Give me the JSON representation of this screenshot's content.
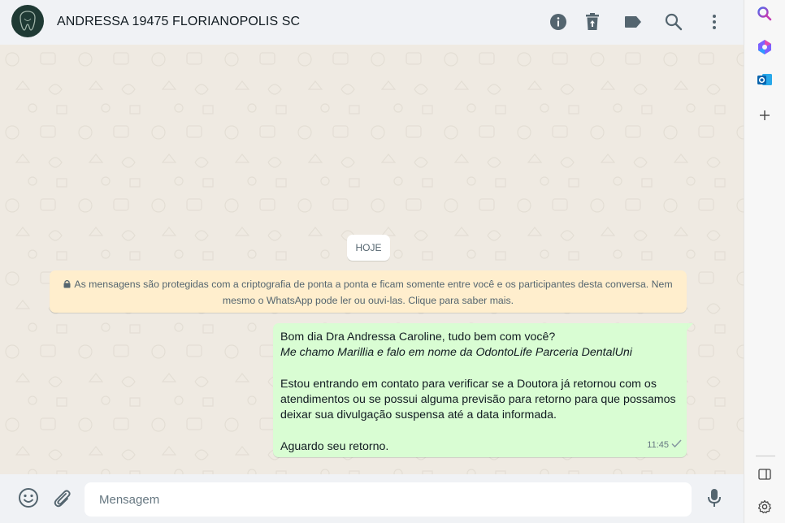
{
  "header": {
    "contact_name": "ANDRESSA 19475 FLORIANOPOLIS SC",
    "icons": [
      "info-icon",
      "delete-icon",
      "label-icon",
      "search-icon",
      "menu-icon"
    ]
  },
  "chat": {
    "date_chip": "HOJE",
    "encryption_notice": "As mensagens são protegidas com a criptografia de ponta a ponta e ficam somente entre você e os participantes desta conversa. Nem mesmo o WhatsApp pode ler ou ouvi-las. Clique para saber mais.",
    "message": {
      "line1": "Bom dia Dra Andressa Caroline, tudo bem com você?",
      "line2": "Me chamo Marillia e falo em nome da OdontoLife Parceria DentalUni",
      "line3": "Estou entrando em contato para verificar se a Doutora já retornou com os atendimentos ou se possui alguma previsão para retorno para que possamos deixar sua divulgação suspensa até a data informada.",
      "line4": "Aguardo seu retorno.",
      "time": "11:45",
      "status": "sent"
    }
  },
  "footer": {
    "placeholder": "Mensagem",
    "value": ""
  },
  "sidebar": {
    "icons": [
      "search-icon",
      "copilot-icon",
      "outlook-icon",
      "add-icon",
      "sidebar-toggle-icon",
      "settings-icon"
    ]
  },
  "colors": {
    "header_bg": "#f0f2f5",
    "chat_bg": "#efeae2",
    "outgoing_bubble": "#d9fdd3",
    "notice_bg": "#ffeecd",
    "avatar_bg": "#1f3a34"
  }
}
